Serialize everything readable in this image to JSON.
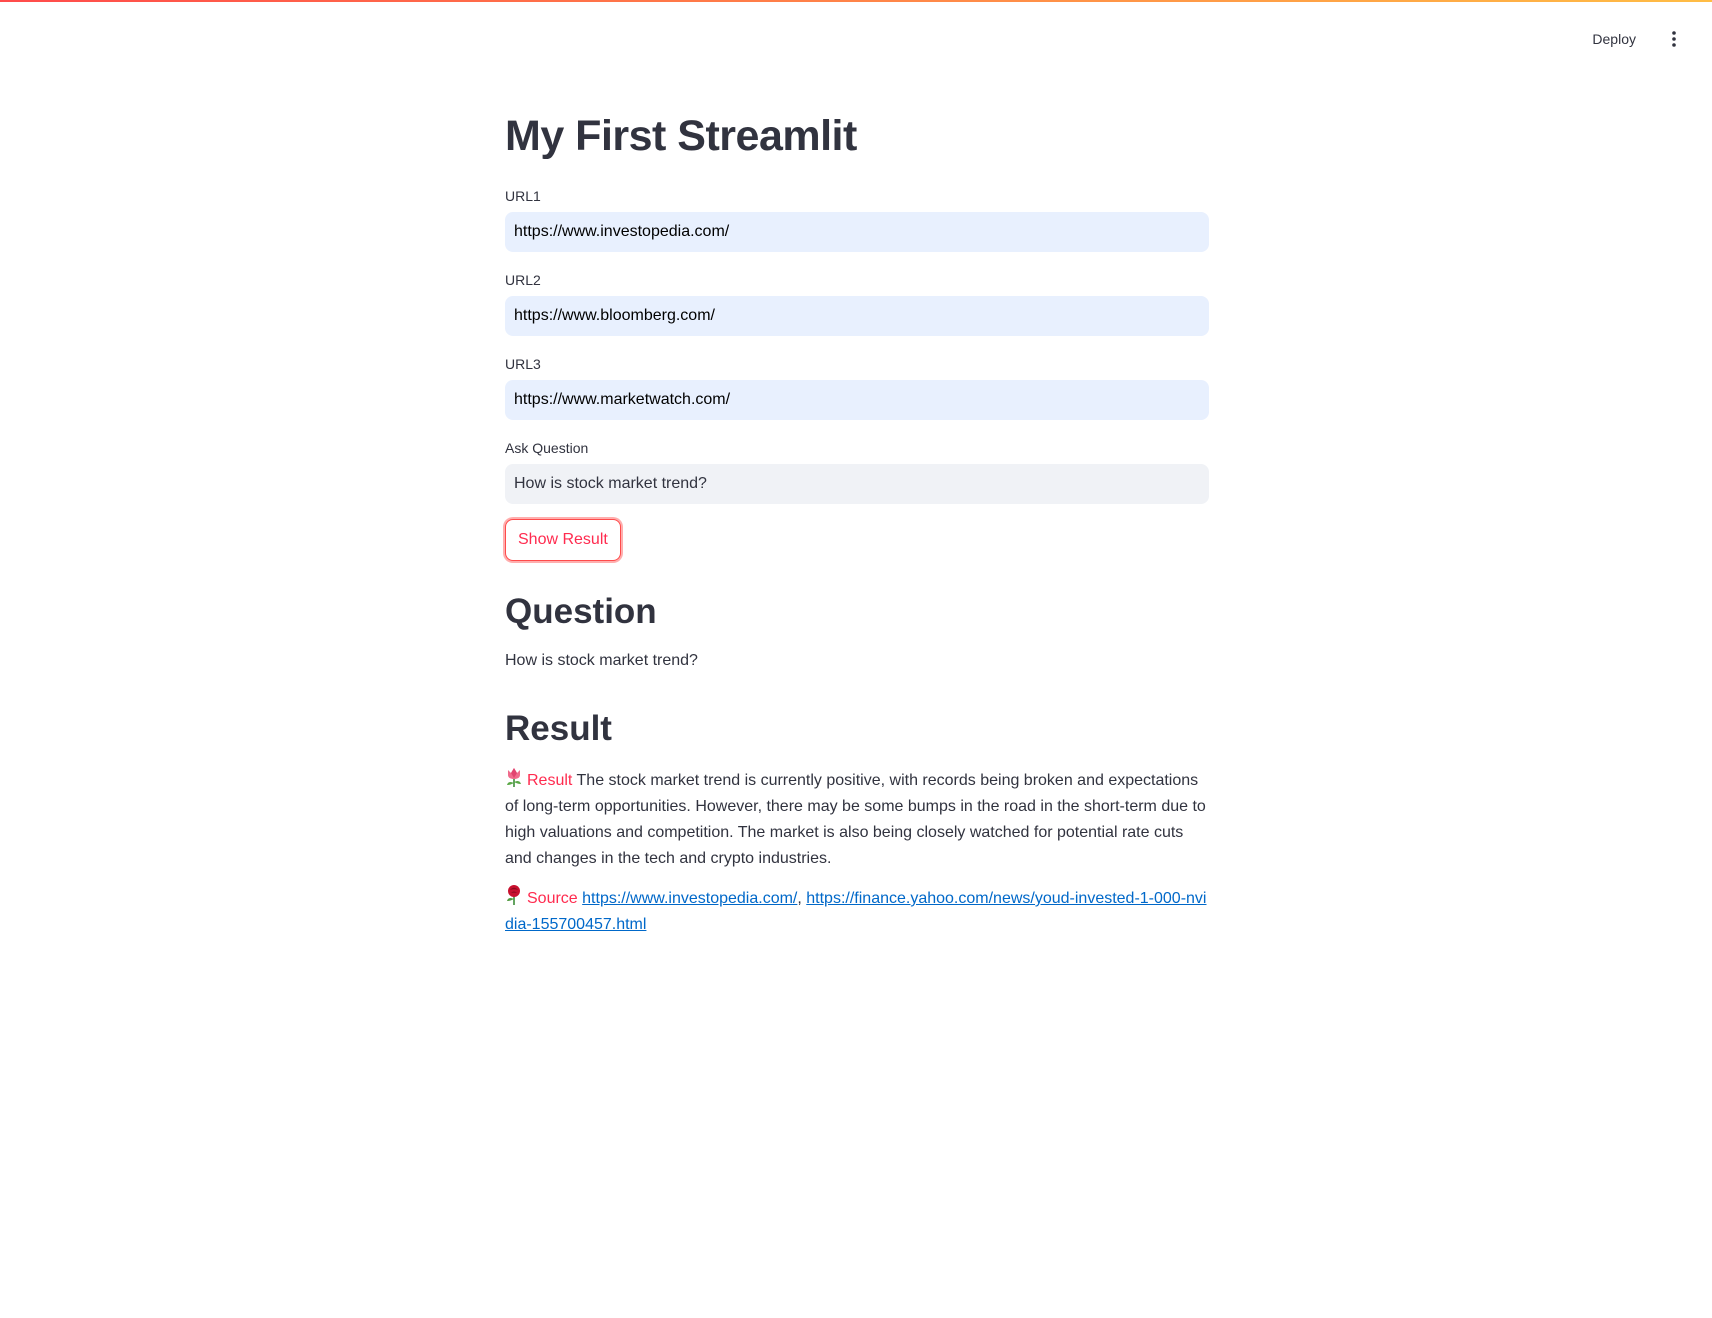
{
  "header": {
    "deploy_label": "Deploy",
    "menu_icon": "more-vertical-icon"
  },
  "main": {
    "title": "My First Streamlit",
    "fields": [
      {
        "label": "URL1",
        "value": "https://www.investopedia.com/"
      },
      {
        "label": "URL2",
        "value": "https://www.bloomberg.com/"
      },
      {
        "label": "URL3",
        "value": "https://www.marketwatch.com/"
      },
      {
        "label": "Ask Question",
        "value": "How is stock market trend?"
      }
    ],
    "button_label": "Show Result",
    "question_heading": "Question",
    "question_text": "How is stock market trend?",
    "result_heading": "Result",
    "result": {
      "icon": "tulip-icon",
      "label": "Result",
      "text": "The stock market trend is currently positive, with records being broken and expectations of long-term opportunities. However, there may be some bumps in the road in the short-term due to high valuations and competition. The market is also being closely watched for potential rate cuts and changes in the tech and crypto industries."
    },
    "source": {
      "icon": "rose-icon",
      "label": "Source",
      "links": [
        "https://www.investopedia.com/",
        "https://finance.yahoo.com/news/youd-invested-1-000-nvidia-155700457.html"
      ],
      "separator": ", "
    }
  },
  "colors": {
    "accent": "#ff4b4b",
    "label_red": "#ff2b4f",
    "link": "#0068c9",
    "input_autofill": "#e8f0fe",
    "input_default": "#f0f2f6",
    "text": "#31333f"
  }
}
